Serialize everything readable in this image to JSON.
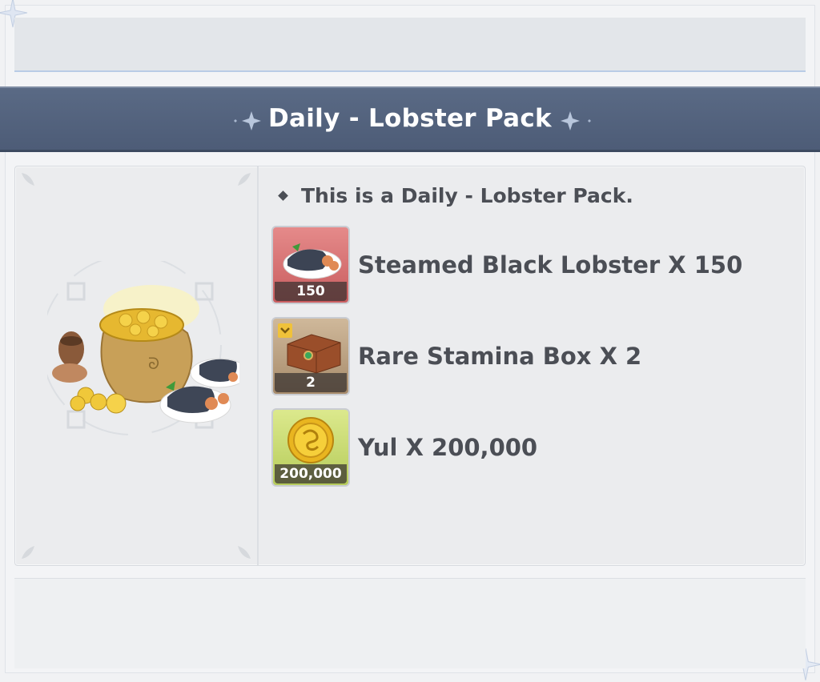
{
  "title": "Daily - Lobster Pack",
  "description": "This is a Daily - Lobster Pack.",
  "items": [
    {
      "label": "Steamed Black Lobster X 150",
      "count": "150",
      "icon": "lobster-plate-icon"
    },
    {
      "label": "Rare Stamina Box X 2",
      "count": "2",
      "icon": "stamina-box-icon"
    },
    {
      "label": "Yul X 200,000",
      "count": "200,000",
      "icon": "yul-coin-icon"
    }
  ],
  "colors": {
    "title_band": "#55647f",
    "text": "#4b4e55",
    "slot_red": "#d46f71",
    "slot_brown": "#b89c7a",
    "slot_green": "#c8da72"
  }
}
